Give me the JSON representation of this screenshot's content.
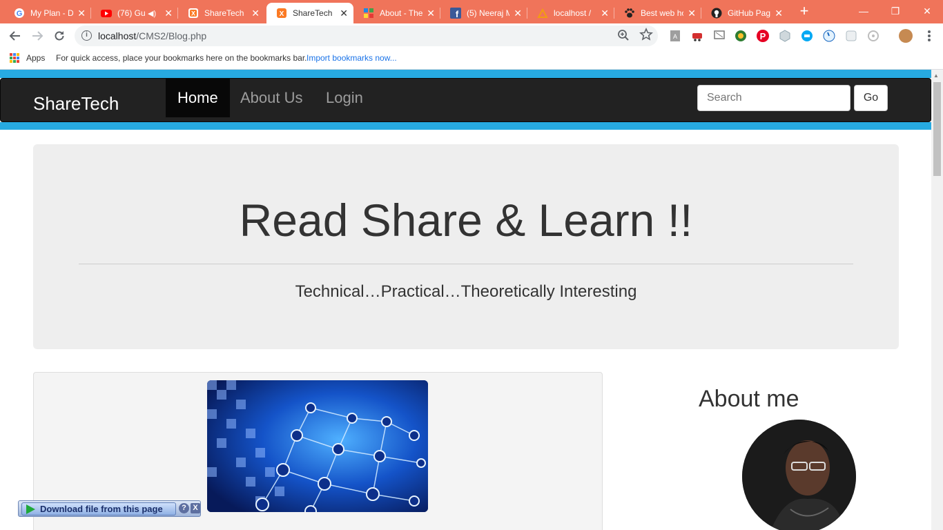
{
  "browser": {
    "tabs": [
      {
        "title": "My Plan - D",
        "icon": "google-icon"
      },
      {
        "title": "(76) Gu",
        "icon": "youtube-icon",
        "audio": true
      },
      {
        "title": "ShareTech",
        "icon": "xampp-icon"
      },
      {
        "title": "ShareTech",
        "icon": "xampp-icon",
        "active": true
      },
      {
        "title": "About - The",
        "icon": "grid-icon"
      },
      {
        "title": "(5) Neeraj M",
        "icon": "facebook-icon"
      },
      {
        "title": "localhost /",
        "icon": "phpmyadmin-icon"
      },
      {
        "title": "Best web ho",
        "icon": "paw-icon"
      },
      {
        "title": "GitHub Pag",
        "icon": "github-icon"
      }
    ],
    "close_glyph": "✕",
    "new_tab_glyph": "+",
    "window_controls": {
      "minimize": "—",
      "restore": "❐",
      "close": "✕"
    },
    "url_host": "localhost",
    "url_path": "/CMS2/Blog.php",
    "bookmarks_bar": {
      "apps_label": "Apps",
      "hint": "For quick access, place your bookmarks here on the bookmarks bar.",
      "import_link": "Import bookmarks now..."
    }
  },
  "site": {
    "brand": "ShareTech",
    "nav": [
      {
        "label": "Home",
        "active": true
      },
      {
        "label": "About Us"
      },
      {
        "label": "Login"
      }
    ],
    "search": {
      "placeholder": "Search",
      "button": "Go"
    },
    "accent_color": "#27aae1"
  },
  "hero": {
    "title": "Read Share & Learn !!",
    "subtitle": "Technical…Practical…Theoretically Interesting"
  },
  "sidebar": {
    "about_title": "About me"
  },
  "download_bar": {
    "label": "Download file from this page",
    "help": "?",
    "close": "X"
  }
}
